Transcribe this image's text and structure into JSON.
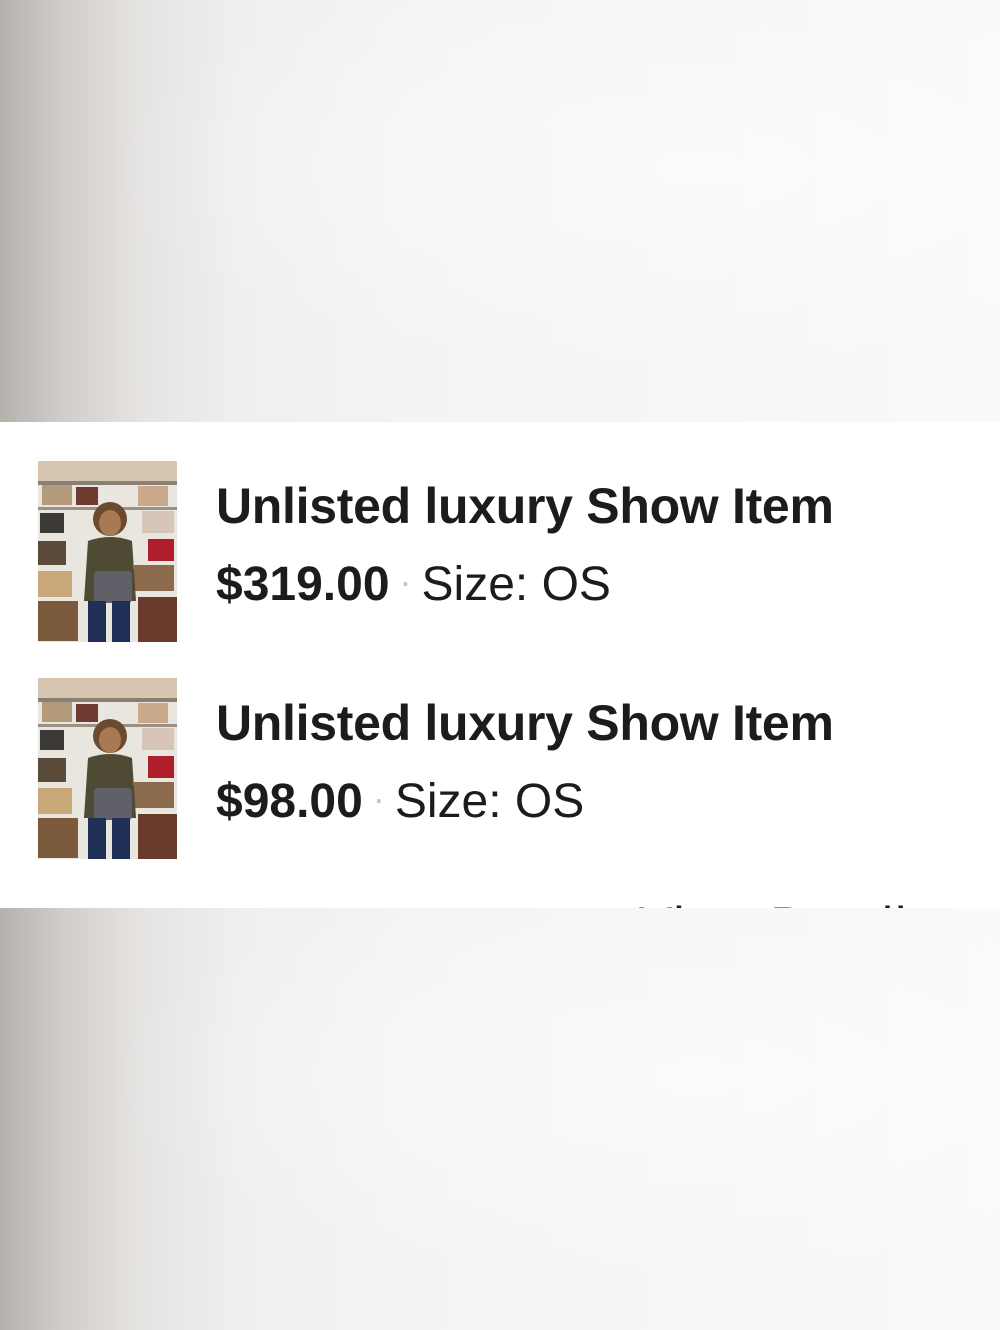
{
  "items": [
    {
      "title": "Unlisted luxury Show Item",
      "price": "$319.00",
      "separator": "·",
      "size": "Size: OS",
      "thumbnail": "seller-photo-with-handbags"
    },
    {
      "title": "Unlisted luxury Show Item",
      "price": "$98.00",
      "separator": "·",
      "size": "Size: OS",
      "thumbnail": "seller-photo-with-handbags"
    }
  ],
  "footer": {
    "view_bundle_label": "View Bundle"
  }
}
